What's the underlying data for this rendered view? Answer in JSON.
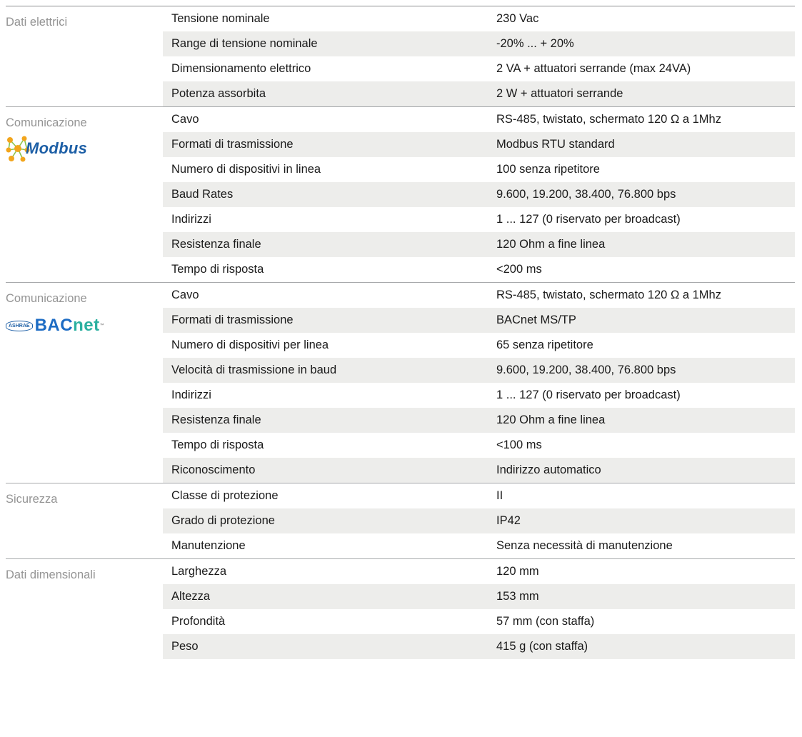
{
  "sections": [
    {
      "category": "Dati elettrici",
      "logo": null,
      "rows": [
        {
          "param": "Tensione nominale",
          "value": "230 Vac"
        },
        {
          "param": "Range di tensione nominale",
          "value": "-20% ... + 20%"
        },
        {
          "param": "Dimensionamento elettrico",
          "value": "2 VA + attuatori serrande (max 24VA)"
        },
        {
          "param": "Potenza assorbita",
          "value": "2 W + attuatori serrande"
        }
      ]
    },
    {
      "category": "Comunicazione",
      "logo": {
        "name": "modbus-logo",
        "text": "Modbus",
        "brand_color": "#1d5fa6",
        "accent_color": "#f2a51c"
      },
      "rows": [
        {
          "param": "Cavo",
          "value": "RS-485, twistato, schermato 120 Ω a 1Mhz"
        },
        {
          "param": "Formati di trasmissione",
          "value": "Modbus RTU standard"
        },
        {
          "param": "Numero di dispositivi in linea",
          "value": "100 senza ripetitore"
        },
        {
          "param": "Baud Rates",
          "value": "9.600, 19.200, 38.400, 76.800 bps"
        },
        {
          "param": "Indirizzi",
          "value": "1 ... 127 (0 riservato per broadcast)"
        },
        {
          "param": "Resistenza finale",
          "value": "120 Ohm a fine linea"
        },
        {
          "param": "Tempo di risposta",
          "value": "<200 ms"
        }
      ]
    },
    {
      "category": "Comunicazione",
      "logo": {
        "name": "bacnet-logo",
        "badge": "ASHRAE",
        "text_main": "BAC",
        "text_accent": "net",
        "tm": "™",
        "brand_color": "#1d6cc4",
        "accent_color": "#2bb0a0"
      },
      "rows": [
        {
          "param": "Cavo",
          "value": "RS-485, twistato, schermato 120 Ω a 1Mhz"
        },
        {
          "param": "Formati di trasmissione",
          "value": "BACnet MS/TP"
        },
        {
          "param": "Numero di dispositivi per linea",
          "value": "65 senza ripetitore"
        },
        {
          "param": "Velocità di trasmissione in baud",
          "value": "9.600, 19.200, 38.400, 76.800 bps"
        },
        {
          "param": "Indirizzi",
          "value": "1 ... 127 (0 riservato per broadcast)"
        },
        {
          "param": "Resistenza finale",
          "value": "120 Ohm a fine linea"
        },
        {
          "param": "Tempo di risposta",
          "value": "<100 ms"
        },
        {
          "param": "Riconoscimento",
          "value": "Indirizzo automatico"
        }
      ]
    },
    {
      "category": "Sicurezza",
      "logo": null,
      "rows": [
        {
          "param": "Classe di protezione",
          "value": "II"
        },
        {
          "param": "Grado di protezione",
          "value": "IP42"
        },
        {
          "param": "Manutenzione",
          "value": "Senza necessità di manutenzione"
        }
      ]
    },
    {
      "category": "Dati dimensionali",
      "logo": null,
      "rows": [
        {
          "param": "Larghezza",
          "value": "120 mm"
        },
        {
          "param": "Altezza",
          "value": "153 mm"
        },
        {
          "param": "Profondità",
          "value": "57 mm (con staffa)"
        },
        {
          "param": "Peso",
          "value": "415 g (con staffa)"
        }
      ]
    }
  ],
  "colors": {
    "row_alt": "#ededeb",
    "divider": "#a7a9ab",
    "category_text": "#949494",
    "body_text": "#1a1a1a"
  }
}
